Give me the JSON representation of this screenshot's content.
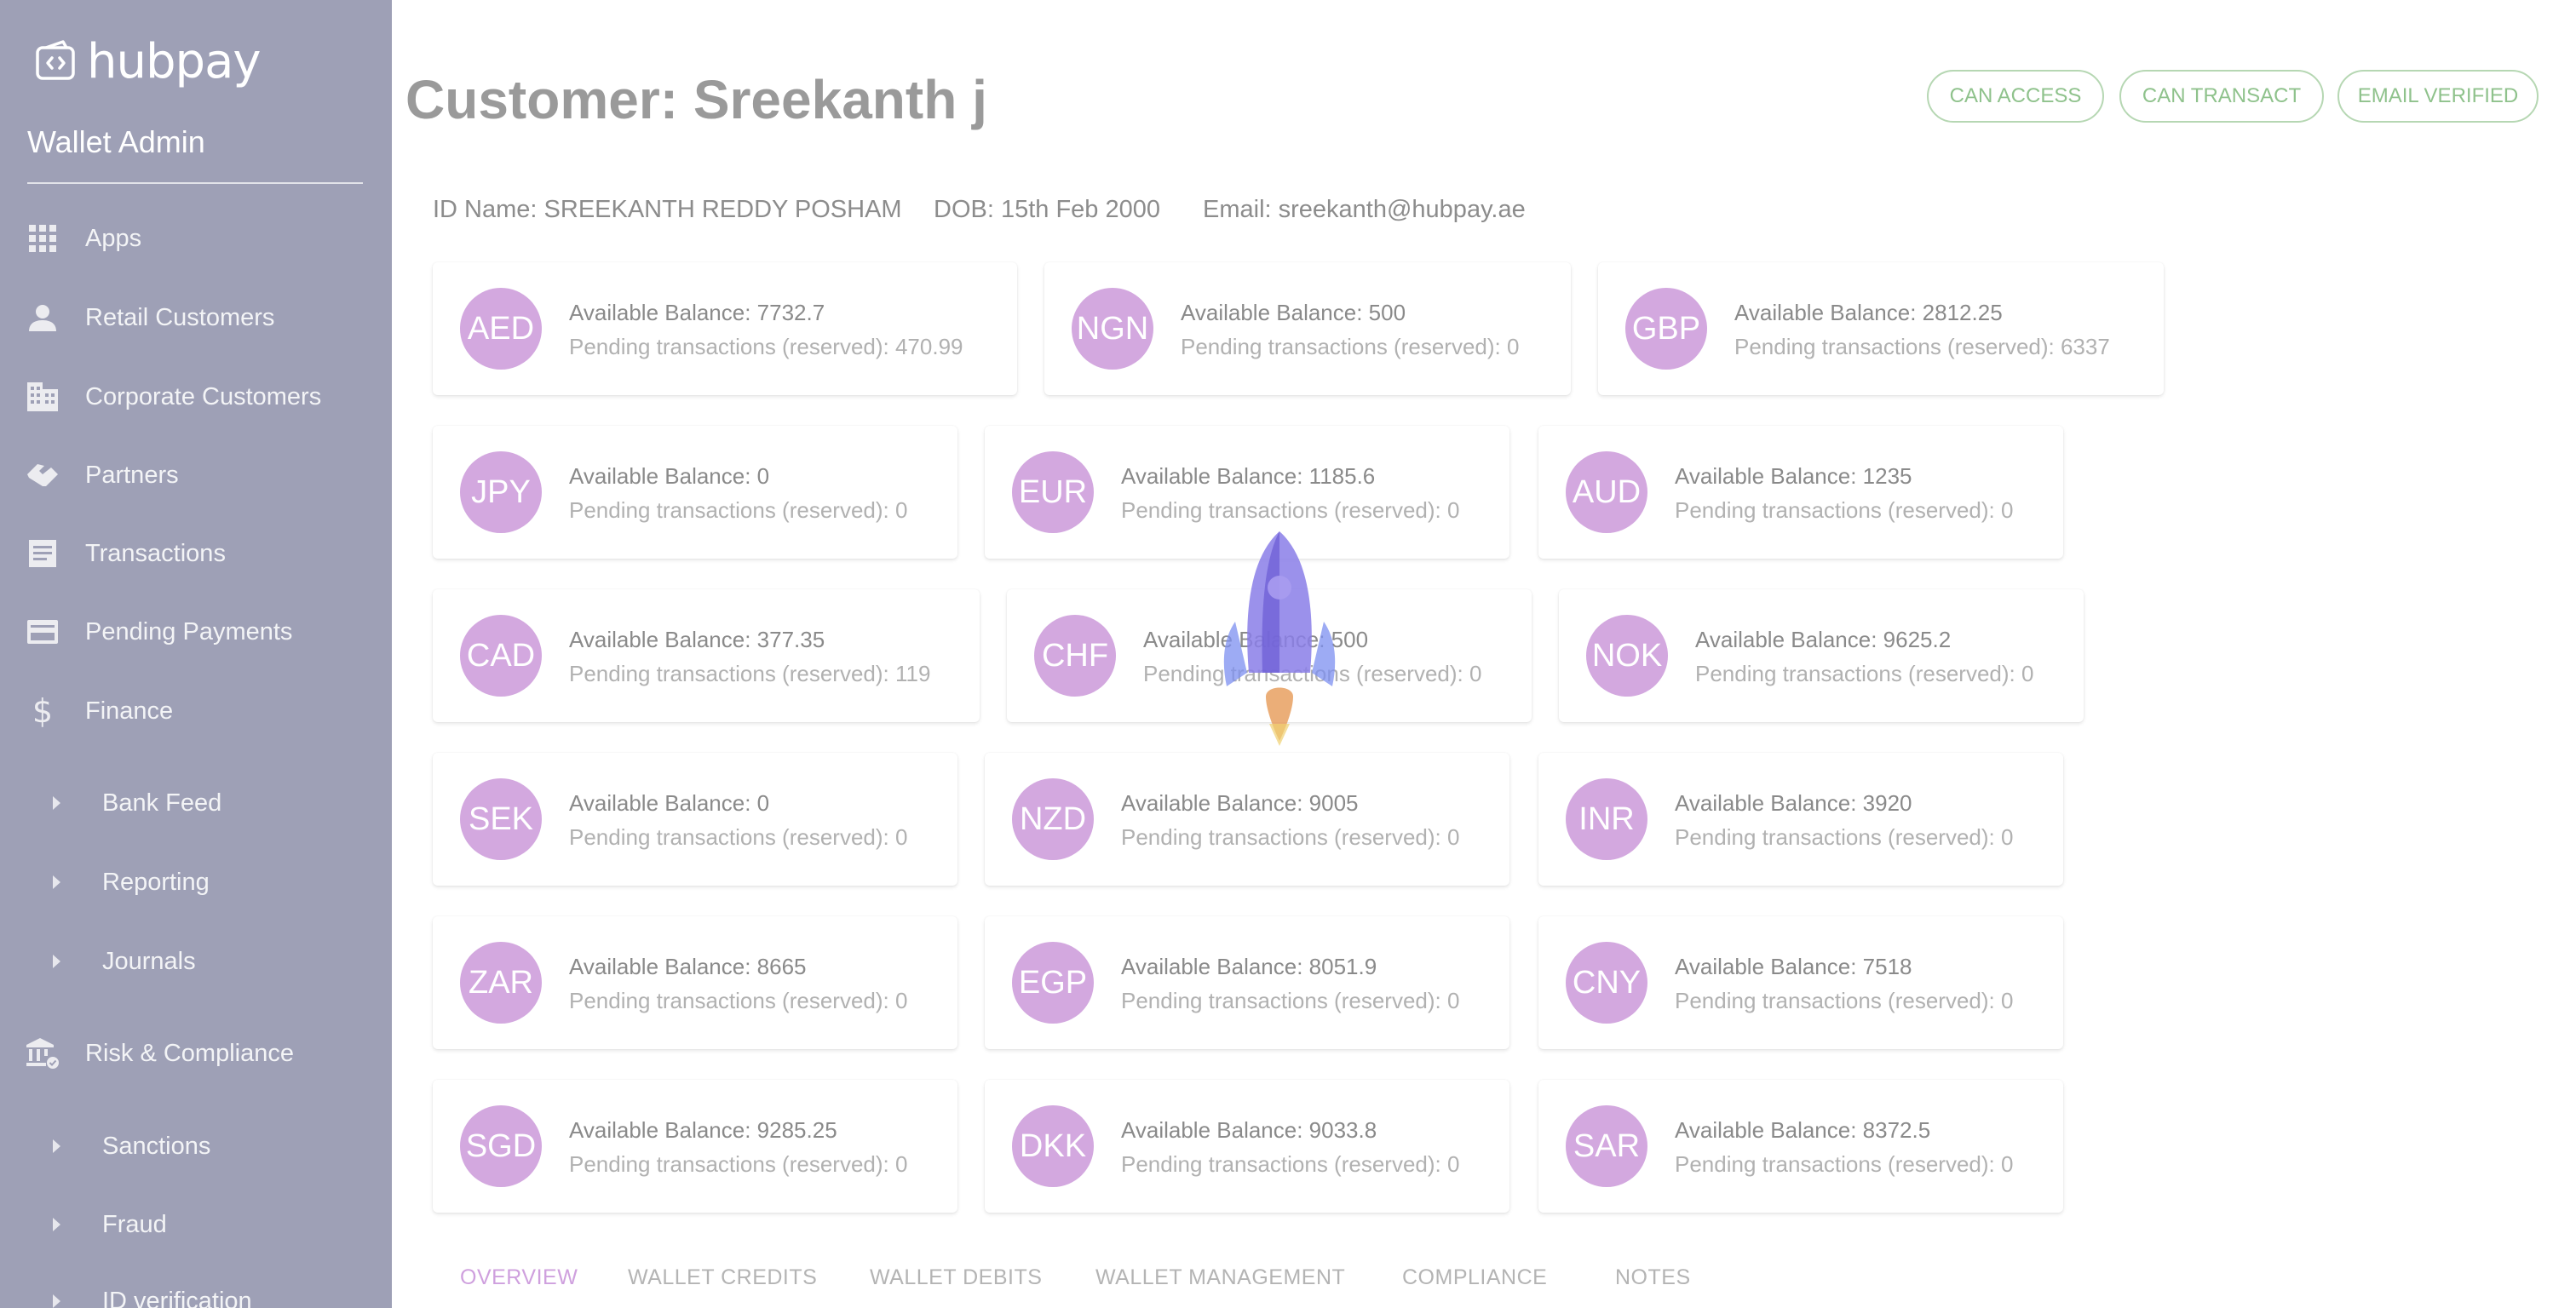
{
  "brand": {
    "name": "hubpay"
  },
  "sidebar": {
    "title": "Wallet Admin",
    "items": [
      {
        "label": "Apps",
        "icon": "apps-grid-icon"
      },
      {
        "label": "Retail Customers",
        "icon": "person-icon"
      },
      {
        "label": "Corporate Customers",
        "icon": "building-icon"
      },
      {
        "label": "Partners",
        "icon": "handshake-icon"
      },
      {
        "label": "Transactions",
        "icon": "list-icon"
      },
      {
        "label": "Pending Payments",
        "icon": "credit-card-icon"
      },
      {
        "label": "Finance",
        "icon": "dollar-icon"
      },
      {
        "label": "Bank Feed",
        "icon": "caret-right-icon"
      },
      {
        "label": "Reporting",
        "icon": "caret-right-icon"
      },
      {
        "label": "Journals",
        "icon": "caret-right-icon"
      },
      {
        "label": "Risk & Compliance",
        "icon": "bank-check-icon"
      },
      {
        "label": "Sanctions",
        "icon": "caret-right-icon"
      },
      {
        "label": "Fraud",
        "icon": "caret-right-icon"
      },
      {
        "label": "ID verification",
        "icon": "caret-right-icon"
      }
    ]
  },
  "header": {
    "title": "Customer: Sreekanth j",
    "chips": [
      "CAN ACCESS",
      "CAN TRANSACT",
      "EMAIL VERIFIED"
    ]
  },
  "customer": {
    "id_name": "ID Name: SREEKANTH REDDY POSHAM",
    "dob": "DOB: 15th Feb 2000",
    "email": "Email: sreekanth@hubpay.ae"
  },
  "wallets": [
    {
      "currency": "AED",
      "available": "Available Balance: 7732.7",
      "pending": "Pending transactions (reserved): 470.99"
    },
    {
      "currency": "NGN",
      "available": "Available Balance: 500",
      "pending": "Pending transactions (reserved): 0"
    },
    {
      "currency": "GBP",
      "available": "Available Balance: 2812.25",
      "pending": "Pending transactions (reserved): 6337"
    },
    {
      "currency": "JPY",
      "available": "Available Balance: 0",
      "pending": "Pending transactions (reserved): 0"
    },
    {
      "currency": "EUR",
      "available": "Available Balance: 1185.6",
      "pending": "Pending transactions (reserved): 0"
    },
    {
      "currency": "AUD",
      "available": "Available Balance: 1235",
      "pending": "Pending transactions (reserved): 0"
    },
    {
      "currency": "CAD",
      "available": "Available Balance: 377.35",
      "pending": "Pending transactions (reserved): 119"
    },
    {
      "currency": "CHF",
      "available": "Available Balance: 500",
      "pending": "Pending transactions (reserved): 0"
    },
    {
      "currency": "NOK",
      "available": "Available Balance: 9625.2",
      "pending": "Pending transactions (reserved): 0"
    },
    {
      "currency": "SEK",
      "available": "Available Balance: 0",
      "pending": "Pending transactions (reserved): 0"
    },
    {
      "currency": "NZD",
      "available": "Available Balance: 9005",
      "pending": "Pending transactions (reserved): 0"
    },
    {
      "currency": "INR",
      "available": "Available Balance: 3920",
      "pending": "Pending transactions (reserved): 0"
    },
    {
      "currency": "ZAR",
      "available": "Available Balance: 8665",
      "pending": "Pending transactions (reserved): 0"
    },
    {
      "currency": "EGP",
      "available": "Available Balance: 8051.9",
      "pending": "Pending transactions (reserved): 0"
    },
    {
      "currency": "CNY",
      "available": "Available Balance: 7518",
      "pending": "Pending transactions (reserved): 0"
    },
    {
      "currency": "SGD",
      "available": "Available Balance: 9285.25",
      "pending": "Pending transactions (reserved): 0"
    },
    {
      "currency": "DKK",
      "available": "Available Balance: 9033.8",
      "pending": "Pending transactions (reserved): 0"
    },
    {
      "currency": "SAR",
      "available": "Available Balance: 8372.5",
      "pending": "Pending transactions (reserved): 0"
    }
  ],
  "tabs": [
    "OVERVIEW",
    "WALLET CREDITS",
    "WALLET DEBITS",
    "WALLET MANAGEMENT",
    "COMPLIANCE",
    "NOTES"
  ],
  "active_tab": "OVERVIEW",
  "loading_indicator": {
    "icon": "rocket-icon"
  },
  "colors": {
    "sidebar_bg": "#9ea0b6",
    "avatar_bg": "#d3a8df",
    "chip_green": "#8fc28c",
    "active_tab": "#cfa0de"
  }
}
